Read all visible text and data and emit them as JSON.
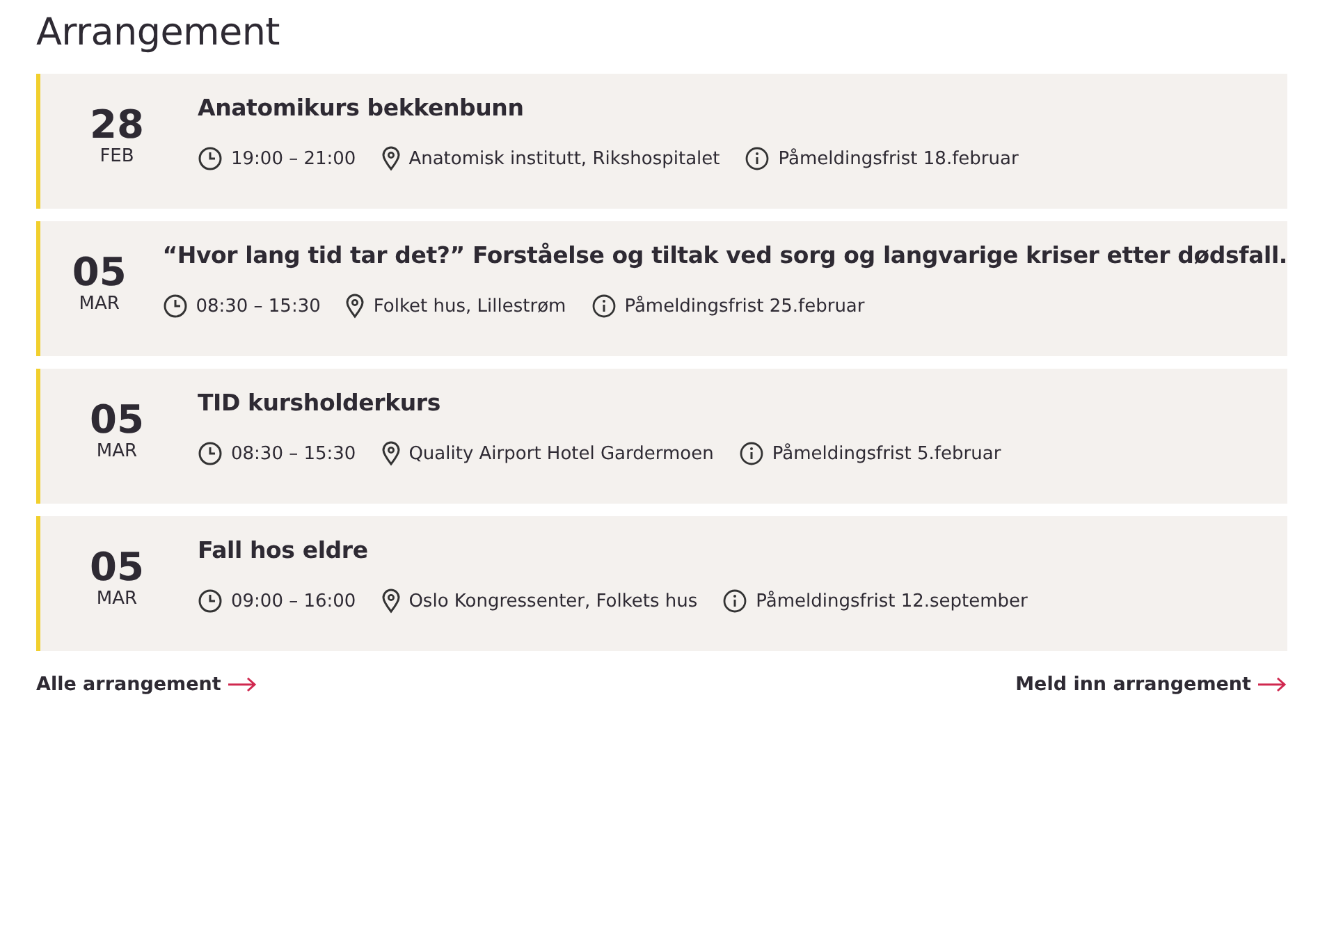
{
  "heading": "Arrangement",
  "events": [
    {
      "day": "28",
      "month": "FEB",
      "title": "Anatomikurs bekkenbunn",
      "time": "19:00 – 21:00",
      "place": "Anatomisk institutt, Rikshospitalet",
      "deadline": "Påmeldingsfrist 18.februar"
    },
    {
      "day": "05",
      "month": "MAR",
      "title": "“Hvor lang tid tar det?” Forståelse og tiltak ved sorg og langvarige kriser etter dødsfall.",
      "time": "08:30 – 15:30",
      "place": "Folket hus, Lillestrøm",
      "deadline": "Påmeldingsfrist 25.februar"
    },
    {
      "day": "05",
      "month": "MAR",
      "title": "TID kursholderkurs",
      "time": "08:30 – 15:30",
      "place": "Quality Airport Hotel Gardermoen",
      "deadline": "Påmeldingsfrist 5.februar"
    },
    {
      "day": "05",
      "month": "MAR",
      "title": "Fall hos eldre",
      "time": "09:00 – 16:00",
      "place": "Oslo Kongressenter, Folkets hus",
      "deadline": "Påmeldingsfrist 12.september"
    }
  ],
  "links": [
    "Alle arrangement",
    "Meld inn arrangement"
  ]
}
